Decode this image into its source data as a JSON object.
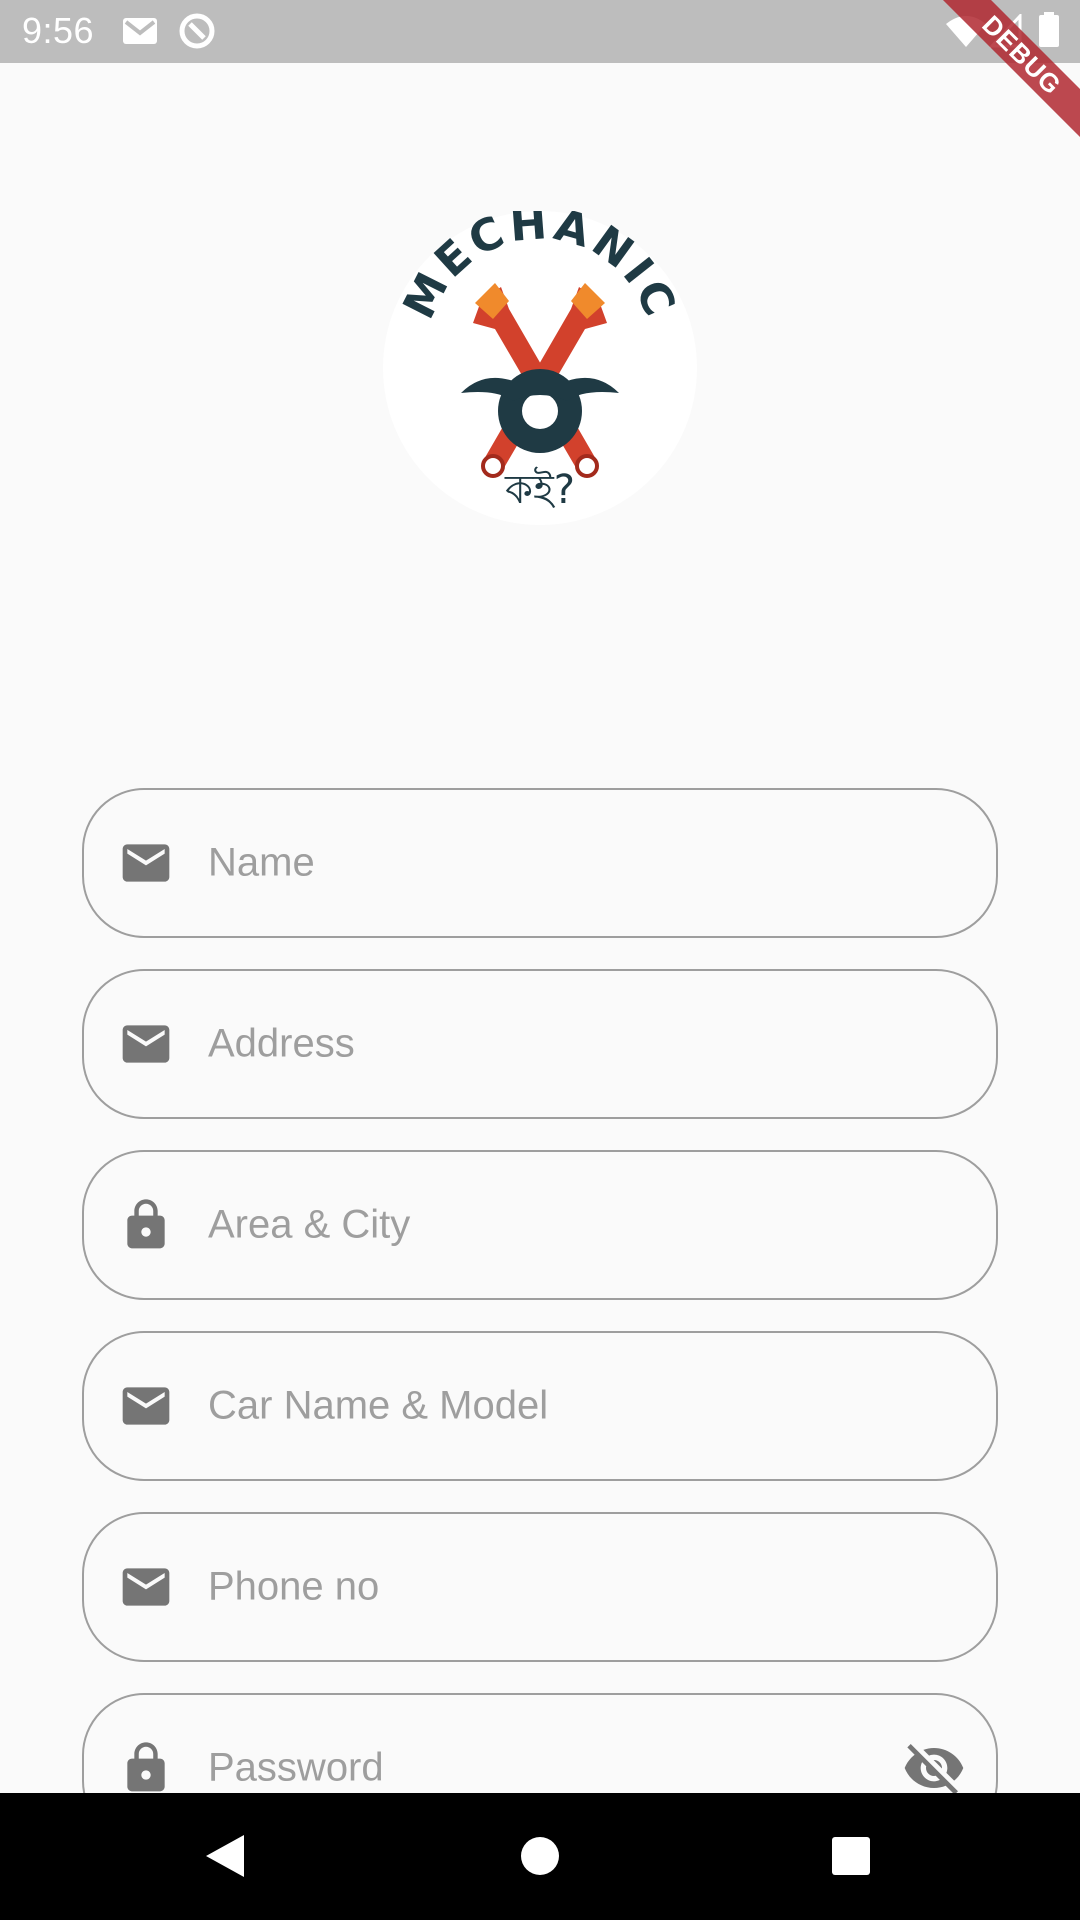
{
  "status_bar": {
    "time": "9:56",
    "icons": [
      "gmail-icon",
      "sync-icon",
      "wifi-icon",
      "signal-icon",
      "battery-icon"
    ]
  },
  "debug_banner": {
    "label": "DEBUG"
  },
  "logo": {
    "text_top": "MECHANIC",
    "text_bottom": "কই?"
  },
  "form": {
    "fields": [
      {
        "placeholder": "Name",
        "icon": "mail-icon"
      },
      {
        "placeholder": "Address",
        "icon": "mail-icon"
      },
      {
        "placeholder": "Area & City",
        "icon": "lock-icon"
      },
      {
        "placeholder": "Car Name & Model",
        "icon": "mail-icon"
      },
      {
        "placeholder": "Phone no",
        "icon": "mail-icon"
      },
      {
        "placeholder": "Password",
        "icon": "lock-icon",
        "trailing_icon": "visibility-off-icon"
      }
    ]
  },
  "nav_bar": {
    "buttons": [
      "back-icon",
      "home-icon",
      "recents-icon"
    ]
  },
  "colors": {
    "status_bar": "#bdbdbd",
    "background": "#fafafa",
    "field_border": "#9e9e9e",
    "icon": "#757575",
    "debug_banner": "#b02830"
  }
}
